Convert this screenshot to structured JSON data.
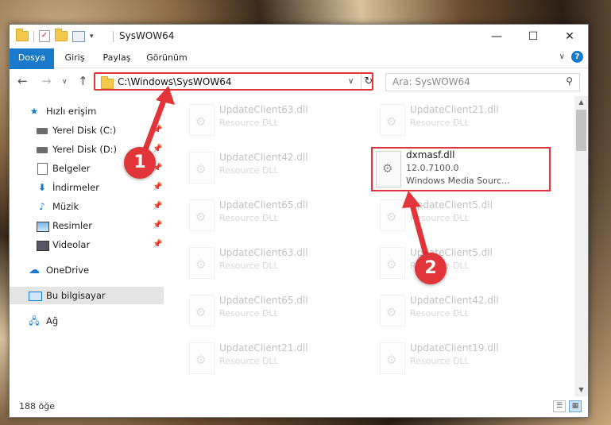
{
  "window": {
    "title": "SysWOW64",
    "controls": {
      "minimize": "—",
      "maximize": "☐",
      "close": "✕"
    }
  },
  "ribbon": {
    "tabs": [
      "Dosya",
      "Giriş",
      "Paylaş",
      "Görünüm"
    ],
    "expand": "∨",
    "help": "?"
  },
  "nav": {
    "back": "←",
    "forward": "→",
    "recent": "∨",
    "up": "↑",
    "address": "C:\\Windows\\SysWOW64",
    "address_dropdown": "∨",
    "refresh": "↻",
    "search_placeholder": "Ara: SysWOW64"
  },
  "sidebar": {
    "items": [
      {
        "label": "Hızlı erişim",
        "icon": "star-icon",
        "pinned": false
      },
      {
        "label": "Yerel Disk (C:)",
        "icon": "drive-icon",
        "pinned": true
      },
      {
        "label": "Yerel Disk (D:)",
        "icon": "drive-icon",
        "pinned": true
      },
      {
        "label": "Belgeler",
        "icon": "document-icon",
        "pinned": true
      },
      {
        "label": "İndirmeler",
        "icon": "download-icon",
        "pinned": true
      },
      {
        "label": "Müzik",
        "icon": "music-icon",
        "pinned": true
      },
      {
        "label": "Resimler",
        "icon": "pictures-icon",
        "pinned": true
      },
      {
        "label": "Videolar",
        "icon": "videos-icon",
        "pinned": true
      },
      {
        "label": "OneDrive",
        "icon": "cloud-icon",
        "pinned": false
      },
      {
        "label": "Bu bilgisayar",
        "icon": "computer-icon",
        "pinned": false,
        "selected": true
      },
      {
        "label": "Ağ",
        "icon": "network-icon",
        "pinned": false
      }
    ],
    "pin_glyph": "📌"
  },
  "files": [
    {
      "name": "UpdateClient63.dll",
      "type": "Resource DLL"
    },
    {
      "name": "UpdateClient21.dll",
      "type": "Resource DLL"
    },
    {
      "name": "UpdateClient42.dll",
      "type": "Resource DLL"
    },
    {
      "name": "dxmasf.dll",
      "version": "12.0.7100.0",
      "description": "Windows Media Sourc...",
      "highlighted": true
    },
    {
      "name": "UpdateClient65.dll",
      "type": "Resource DLL"
    },
    {
      "name": "UpdateClient5.dll",
      "type": "Resource DLL"
    },
    {
      "name": "UpdateClient63.dll",
      "type": "Resource DLL"
    },
    {
      "name": "UpdateClient5.dll",
      "type": "Resource DLL"
    },
    {
      "name": "UpdateClient65.dll",
      "type": "Resource DLL"
    },
    {
      "name": "UpdateClient42.dll",
      "type": "Resource DLL"
    },
    {
      "name": "UpdateClient21.dll",
      "type": "Resource DLL"
    },
    {
      "name": "UpdateClient19.dll",
      "type": "Resource DLL"
    }
  ],
  "status": {
    "count": "188 öğe"
  },
  "annotations": {
    "step1": "1",
    "step2": "2",
    "color": "#e1353a"
  }
}
